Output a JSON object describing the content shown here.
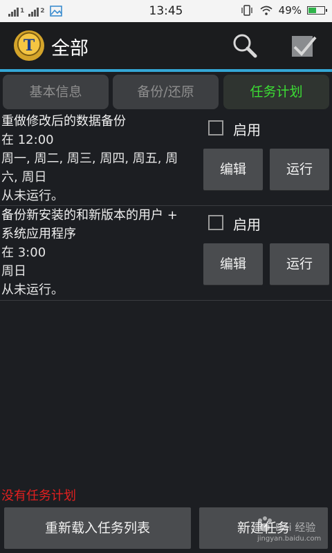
{
  "status_bar": {
    "sim1_label": "1",
    "sim2_label": "2",
    "time": "13:45",
    "battery": "49%",
    "battery_level": 0.49
  },
  "action_bar": {
    "title": "全部",
    "icons": [
      "app-logo-icon",
      "search-icon",
      "checkmark-icon"
    ]
  },
  "tabs": [
    {
      "label": "基本信息",
      "active": false
    },
    {
      "label": "备份/还原",
      "active": false
    },
    {
      "label": "任务计划",
      "active": true
    }
  ],
  "tasks": [
    {
      "name": "重做修改后的数据备份",
      "time": "在 12:00",
      "days_line1": "周一, 周二, 周三, 周四, 周五, 周",
      "days_line2": "六, 周日",
      "last_run": "从未运行。",
      "enable_label": "启用",
      "enabled": false,
      "edit_label": "编辑",
      "run_label": "运行"
    },
    {
      "name_line1": "备份新安装的和新版本的用户 +",
      "name_line2": "系统应用程序",
      "time": "在 3:00",
      "days": "周日",
      "last_run": "从未运行。",
      "enable_label": "启用",
      "enabled": false,
      "edit_label": "编辑",
      "run_label": "运行"
    }
  ],
  "empty_message": "没有任务计划",
  "bottom_buttons": {
    "reload_label": "重新载入任务列表",
    "new_label": "新建任务"
  },
  "watermark": {
    "text": "Bai 经验",
    "url": "jingyan.baidu.com"
  },
  "colors": {
    "accent": "#34a7d6",
    "active_tab_text": "#3cde34",
    "empty_message": "#e32020",
    "background": "#1c1e22"
  }
}
